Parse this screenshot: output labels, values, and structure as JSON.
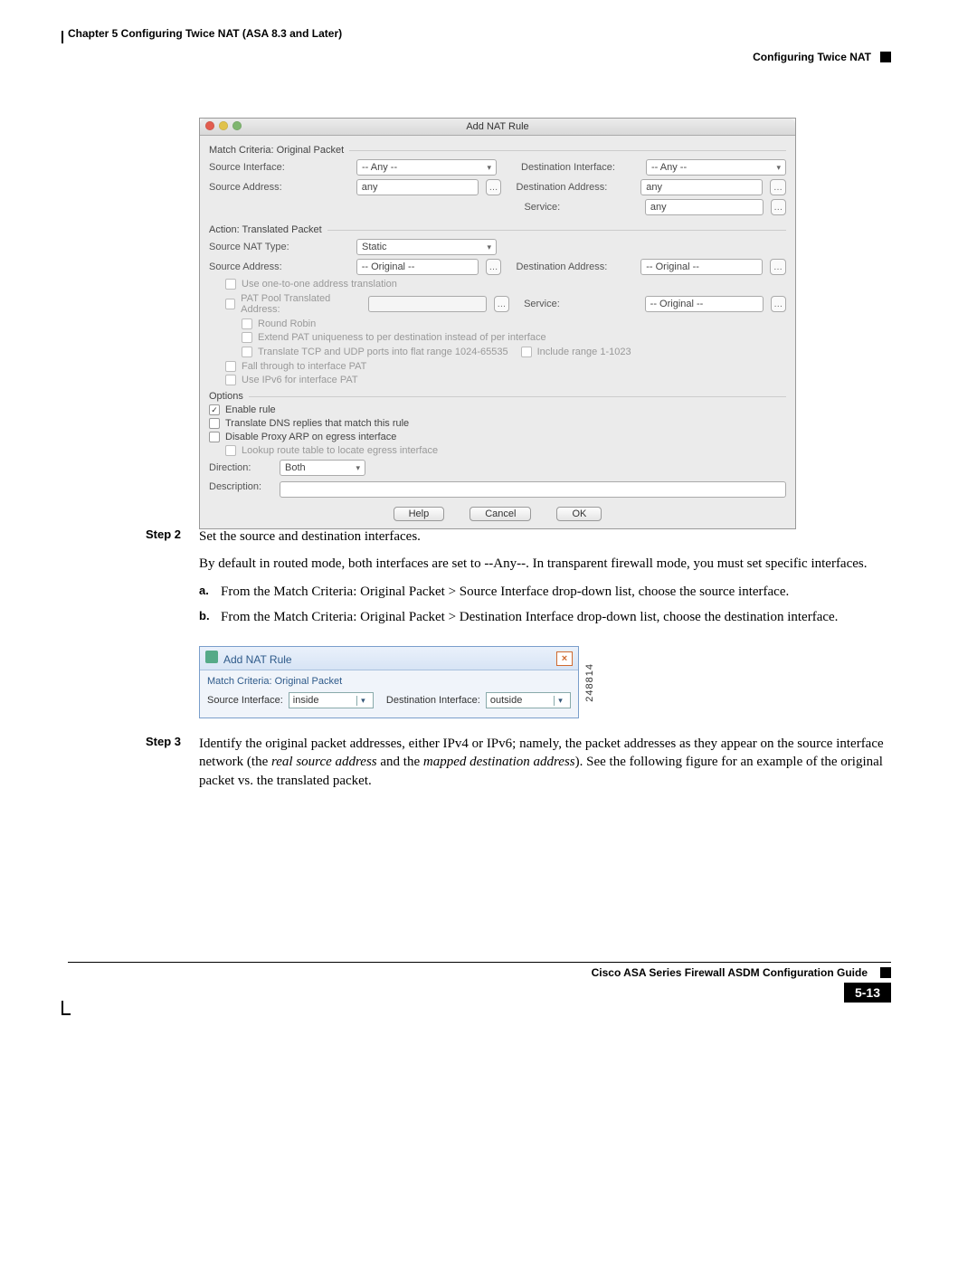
{
  "header": {
    "chapter": "Chapter 5      Configuring Twice NAT (ASA 8.3 and Later)",
    "section": "Configuring Twice NAT"
  },
  "dialog1": {
    "title": "Add NAT Rule",
    "match_section": "Match Criteria: Original Packet",
    "src_if_label": "Source Interface:",
    "src_if_value": "-- Any --",
    "dst_if_label": "Destination Interface:",
    "dst_if_value": "-- Any --",
    "src_addr_label": "Source Address:",
    "src_addr_value": "any",
    "dst_addr_label": "Destination Address:",
    "dst_addr_value": "any",
    "service_label": "Service:",
    "service_value": "any",
    "action_section": "Action: Translated Packet",
    "nat_type_label": "Source NAT Type:",
    "nat_type_value": "Static",
    "t_src_addr_label": "Source Address:",
    "t_src_addr_value": "-- Original --",
    "t_dst_addr_label": "Destination Address:",
    "t_dst_addr_value": "-- Original --",
    "chk_one2one": "Use one-to-one address translation",
    "chk_patpool": "PAT Pool Translated Address:",
    "t_service_label": "Service:",
    "t_service_value": "-- Original --",
    "chk_rr": "Round Robin",
    "chk_extend": "Extend PAT uniqueness to per destination instead of per interface",
    "chk_flat": "Translate TCP and UDP ports into flat range 1024-65535",
    "chk_include": "Include range 1-1023",
    "chk_fallthrough": "Fall through to interface PAT",
    "chk_ipv6": "Use IPv6 for interface PAT",
    "options_section": "Options",
    "chk_enable": "Enable rule",
    "chk_dns": "Translate DNS replies that match this rule",
    "chk_proxyarp": "Disable Proxy ARP on egress interface",
    "chk_lookup": "Lookup route table to locate egress interface",
    "direction_label": "Direction:",
    "direction_value": "Both",
    "description_label": "Description:",
    "btn_help": "Help",
    "btn_cancel": "Cancel",
    "btn_ok": "OK"
  },
  "step2": {
    "label": "Step 2",
    "sentence1": "Set the source and destination interfaces.",
    "sentence2": "By default in routed mode, both interfaces are set to --Any--. In transparent firewall mode, you must set specific interfaces.",
    "a": "From the Match Criteria: Original Packet > Source Interface drop-down list, choose the source interface.",
    "b": "From the Match Criteria: Original Packet > Destination Interface drop-down list, choose the destination interface."
  },
  "dialog2": {
    "title": "Add NAT Rule",
    "section": "Match Criteria: Original Packet",
    "src_if_label": "Source Interface:",
    "src_if_value": "inside",
    "dst_if_label": "Destination Interface:",
    "dst_if_value": "outside",
    "fig_id": "248814"
  },
  "step3": {
    "label": "Step 3",
    "text_a": "Identify the original packet addresses, either IPv4 or IPv6; namely, the packet addresses as they appear on the source interface network (the ",
    "text_b": "real source address",
    "text_c": " and the ",
    "text_d": "mapped destination address",
    "text_e": "). See the following figure for an example of the original packet vs. the translated packet."
  },
  "footer": {
    "guide": "Cisco ASA Series Firewall ASDM Configuration Guide",
    "page": "5-13"
  },
  "sublabels": {
    "a": "a.",
    "b": "b."
  }
}
